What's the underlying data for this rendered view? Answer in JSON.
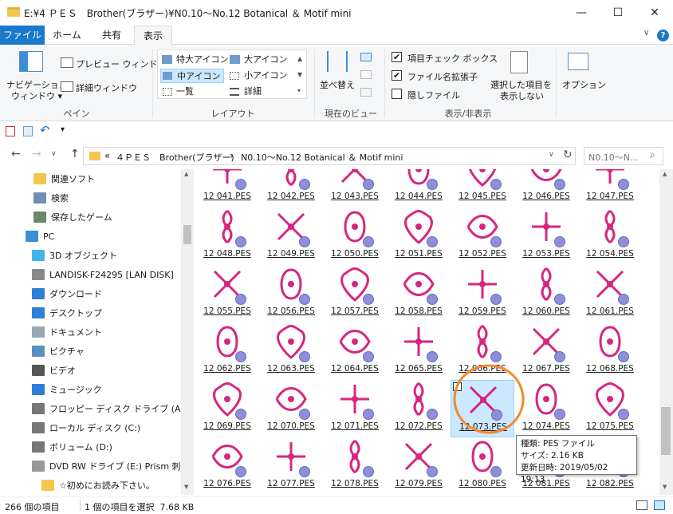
{
  "window": {
    "title": "E:¥4 ＰＥＳ　Brother(ブラザー)¥N0.10～No.12 Botanical ＆ Motif mini",
    "minimize_glyph": "—",
    "maximize_glyph": "☐",
    "close_glyph": "✕"
  },
  "ribbon_tabs": [
    {
      "label": "ファイル"
    },
    {
      "label": "ホーム"
    },
    {
      "label": "共有"
    },
    {
      "label": "表示"
    }
  ],
  "ribbon_help": "?",
  "ribbon_chevron": "∨",
  "ribbon": {
    "pane_group": {
      "nav_pane_label1": "ナビゲーション",
      "nav_pane_label2": "ウィンドウ ▾",
      "preview_label": "プレビュー ウィンドウ",
      "details_label": "詳細ウィンドウ",
      "group_label": "ペイン"
    },
    "layout_group": {
      "items": [
        "特大アイコン",
        "大アイコン",
        "中アイコン",
        "小アイコン",
        "一覧",
        "詳細"
      ],
      "group_label": "レイアウト"
    },
    "view_group": {
      "sort_label": "並べ替え",
      "group_label": "現在のビュー"
    },
    "showhide_group": {
      "item_checkboxes": "項目チェック ボックス",
      "file_ext": "ファイル名拡張子",
      "hidden_files": "隠しファイル",
      "hide_selected1": "選択した項目を",
      "hide_selected2": "表示しない",
      "group_label": "表示/非表示"
    },
    "options_label": "オプション"
  },
  "address": {
    "path_prefix": "«",
    "path_1": "４ＰＥＳ　Brother(ブラザー)",
    "path_sep": "›",
    "path_2": "N0.10～No.12 Botanical ＆ Motif mini",
    "search_placeholder": "N0.10～N...",
    "refresh_glyph": "↻",
    "dropdown_glyph": "∨"
  },
  "nav_buttons": {
    "back": "←",
    "forward": "→",
    "recent": "∨",
    "up": "↑"
  },
  "nav_pane": [
    {
      "label": "関連ソフト",
      "icon": "folder-icon",
      "color": "#f3c74b"
    },
    {
      "label": "検索",
      "icon": "search-icon",
      "color": "#6f8fb3"
    },
    {
      "label": "保存したゲーム",
      "icon": "saved-games-icon",
      "color": "#6a8a6a"
    },
    {
      "label": "PC",
      "icon": "pc-icon",
      "color": "#3c8fd6"
    },
    {
      "label": "3D オブジェクト",
      "icon": "3d-objects-icon",
      "color": "#3fb6e6"
    },
    {
      "label": "LANDISK-F24295 [LAN DISK]",
      "icon": "network-drive-icon",
      "color": "#888888"
    },
    {
      "label": "ダウンロード",
      "icon": "downloads-icon",
      "color": "#2f7ed8"
    },
    {
      "label": "デスクトップ",
      "icon": "desktop-icon",
      "color": "#2f7ed8"
    },
    {
      "label": "ドキュメント",
      "icon": "documents-icon",
      "color": "#9aa8b5"
    },
    {
      "label": "ピクチャ",
      "icon": "pictures-icon",
      "color": "#5a8fc0"
    },
    {
      "label": "ビデオ",
      "icon": "videos-icon",
      "color": "#555555"
    },
    {
      "label": "ミュージック",
      "icon": "music-icon",
      "color": "#2f7ed8"
    },
    {
      "label": "フロッピー ディスク ドライブ (A:)",
      "icon": "floppy-icon",
      "color": "#777777"
    },
    {
      "label": "ローカル ディスク (C:)",
      "icon": "local-disk-icon",
      "color": "#777777"
    },
    {
      "label": "ボリューム (D:)",
      "icon": "volume-icon",
      "color": "#777777"
    },
    {
      "label": "DVD RW ドライブ (E:) Prism 刺繍",
      "icon": "dvd-icon",
      "color": "#999999"
    },
    {
      "label": "☆初めにお読み下さい。",
      "icon": "folder-icon",
      "color": "#f3c74b"
    }
  ],
  "files": [
    "12 041.PES",
    "12 042.PES",
    "12 043.PES",
    "12 044.PES",
    "12 045.PES",
    "12 046.PES",
    "12 047.PES",
    "12 048.PES",
    "12 049.PES",
    "12 050.PES",
    "12 051.PES",
    "12 052.PES",
    "12 053.PES",
    "12 054.PES",
    "12 055.PES",
    "12 056.PES",
    "12 057.PES",
    "12 058.PES",
    "12 059.PES",
    "12 060.PES",
    "12 061.PES",
    "12 062.PES",
    "12 063.PES",
    "12 064.PES",
    "12 065.PES",
    "12 066.PES",
    "12 067.PES",
    "12 068.PES",
    "12 069.PES",
    "12 070.PES",
    "12 071.PES",
    "12 072.PES",
    "12 073.PES",
    "12 074.PES",
    "12 075.PES",
    "12 076.PES",
    "12 077.PES",
    "12 078.PES",
    "12 079.PES",
    "12 080.PES",
    "12 081.PES",
    "12 082.PES"
  ],
  "selected_file": "12 073.PES",
  "tooltip": {
    "line1": "種類: PES ファイル",
    "line2": "サイズ: 2.16 KB",
    "line3": "更新日時: 2019/05/02 19:13"
  },
  "status": {
    "count": "266 個の項目",
    "selection": "1 個の項目を選択  7.68 KB"
  },
  "colors": {
    "accent": "#1979ca",
    "embroidery": "#d6267f",
    "highlight_circle": "#f08a2c",
    "selection_bg": "#cce8ff"
  }
}
